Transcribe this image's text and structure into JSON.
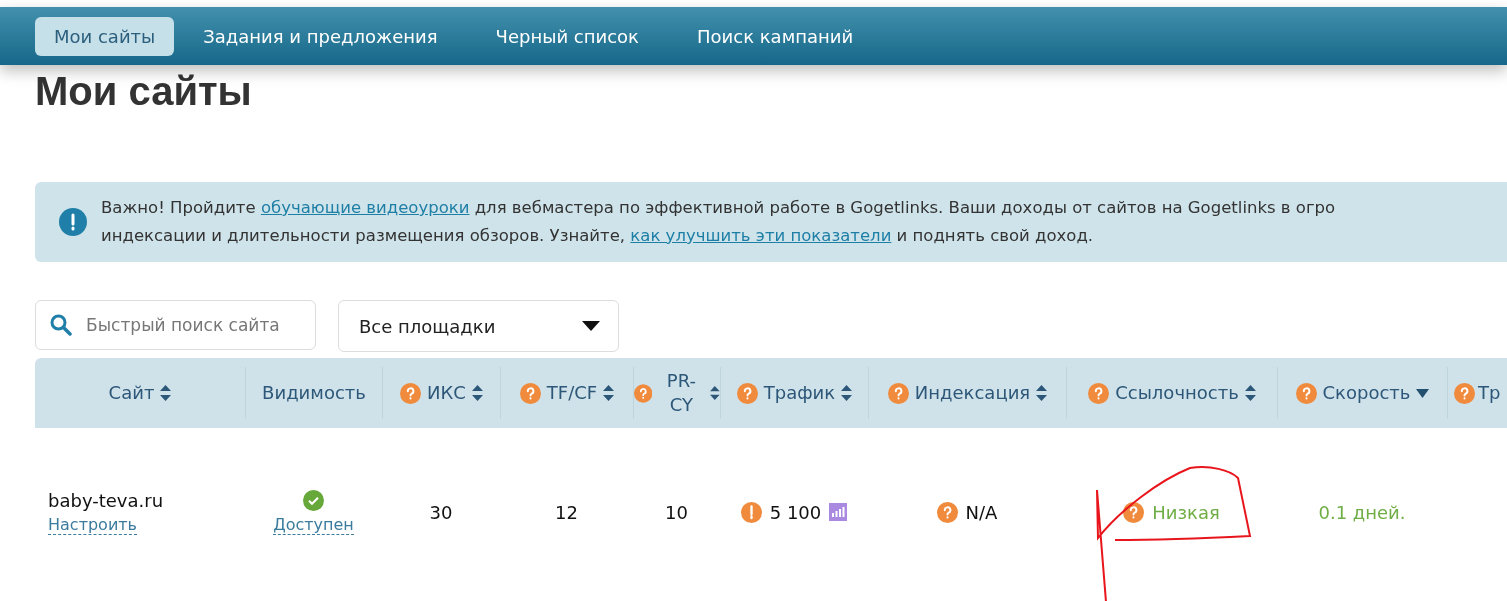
{
  "nav": {
    "tabs": [
      {
        "label": "Мои сайты",
        "selected": true
      },
      {
        "label": "Задания и предложения",
        "selected": false
      },
      {
        "label": "Черный список",
        "selected": false
      },
      {
        "label": "Поиск кампаний",
        "selected": false
      }
    ]
  },
  "page_title": "Мои сайты",
  "alert": {
    "lines": [
      [
        {
          "text": "Важно! Пройдите "
        },
        {
          "text": "обучающие видеоуроки",
          "link": true
        },
        {
          "text": " для вебмастера по эффективной работе в Gogetlinks. Ваши доходы от сайтов на Gogetlinks в огро"
        }
      ],
      [
        {
          "text": "индексации и длительности размещения обзоров. Узнайте, "
        },
        {
          "text": "как улучшить эти показатели",
          "link": true
        },
        {
          "text": " и поднять свой доход."
        }
      ]
    ]
  },
  "filters": {
    "search": {
      "placeholder": "Быстрый поиск сайта"
    },
    "dropdown": {
      "value": "Все площадки"
    }
  },
  "table": {
    "columns": [
      {
        "label": "Сайт",
        "sortable": true,
        "sorted_desc": false
      },
      {
        "label": "Видимость"
      },
      {
        "label": "ИКС",
        "help": true,
        "sortable": true,
        "sorted_desc": false
      },
      {
        "label": "TF/CF",
        "help": true,
        "sortable": true,
        "sorted_desc": false
      },
      {
        "label": "PR-CY",
        "help": true,
        "sortable": true,
        "sorted_desc": false
      },
      {
        "label": "Трафик",
        "help": true,
        "sortable": true,
        "sorted_desc": false
      },
      {
        "label": "Индексация",
        "help": true,
        "sortable": true,
        "sorted_desc": false
      },
      {
        "label": "Ссылочность",
        "help": true,
        "sortable": true,
        "sorted_desc": false
      },
      {
        "label": "Скорость",
        "help": true,
        "sortable": true,
        "sorted_desc": true
      },
      {
        "label": "Тр",
        "help": true
      }
    ],
    "rows": [
      {
        "site": "baby-teva.ru",
        "site_action": "Настроить",
        "visibility": {
          "available": true,
          "label": "Доступен"
        },
        "iks": "30",
        "tf_cf": "12",
        "pr_cy": "10",
        "traffic": {
          "warning": true,
          "value": "5 100",
          "chart": true
        },
        "indexation": {
          "help": true,
          "value": "N/A",
          "positive": false
        },
        "links": {
          "help": true,
          "value": "Низкая",
          "positive": true
        },
        "speed": {
          "value": "0.1 дней.",
          "positive": true
        }
      }
    ]
  },
  "annotation": {
    "kind": "hand-drawn"
  }
}
